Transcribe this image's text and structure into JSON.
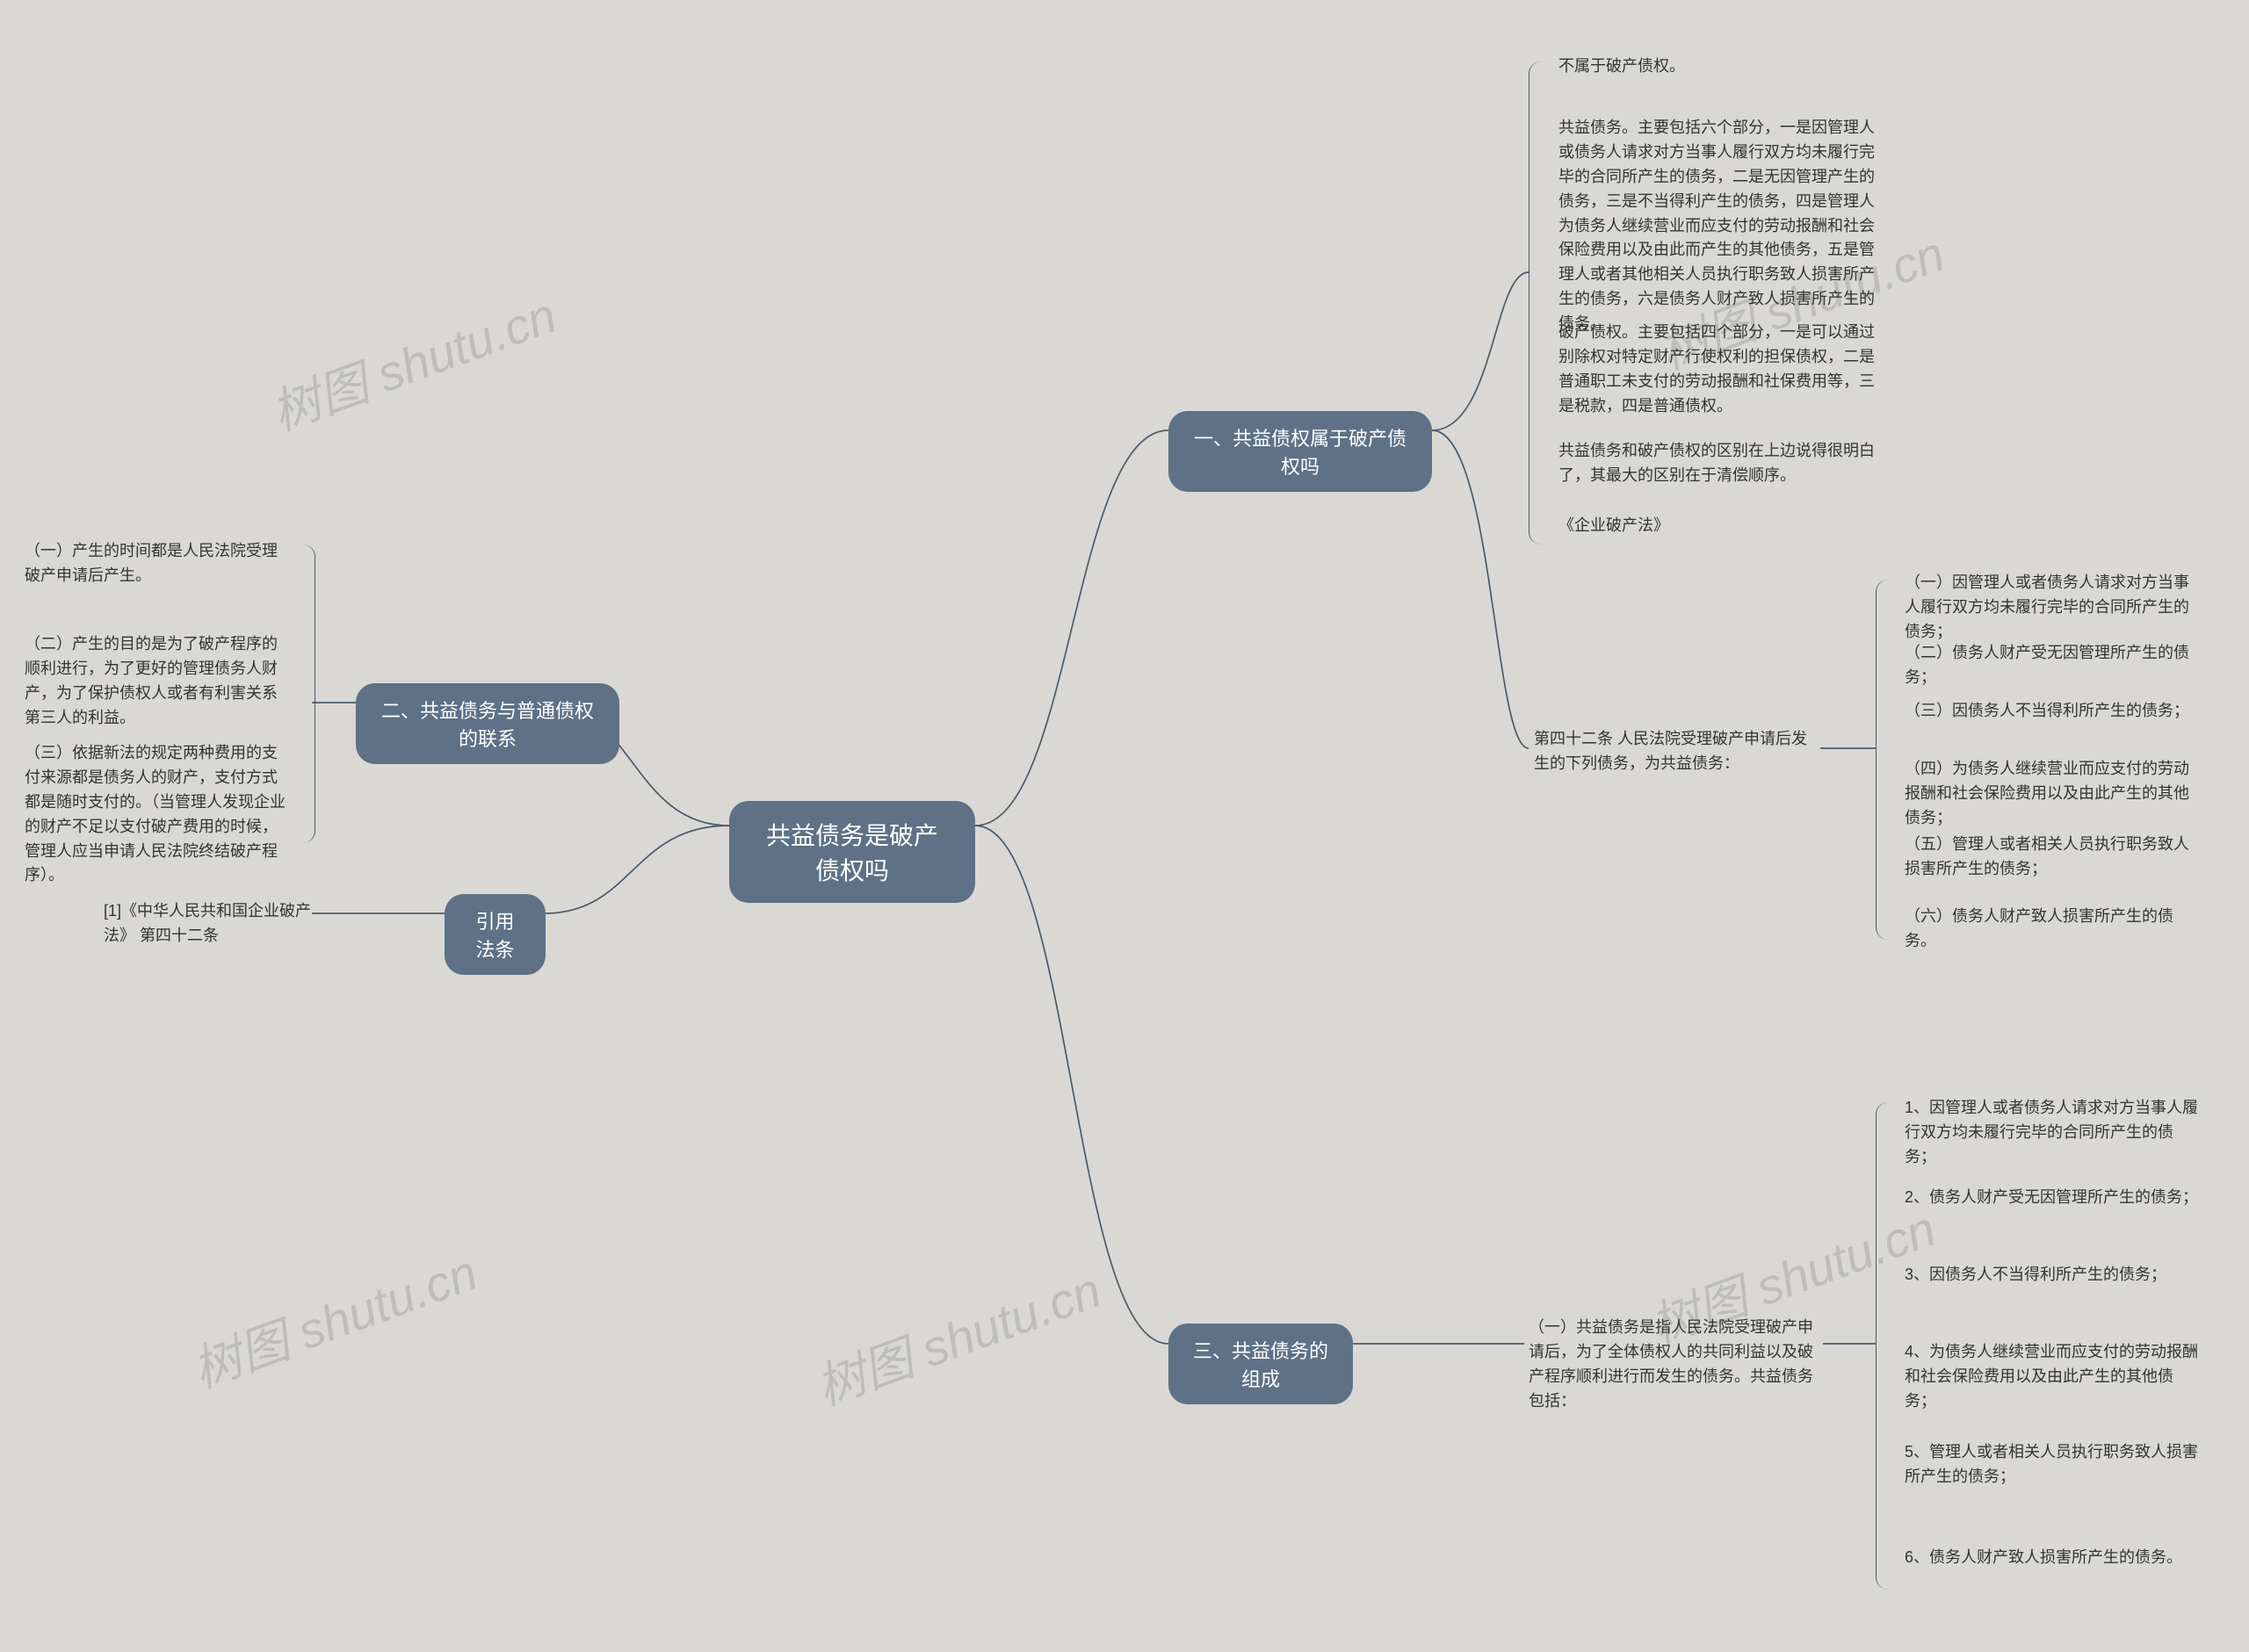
{
  "root": "共益债务是破产债权吗",
  "watermark": "树图 shutu.cn",
  "right": {
    "n1": {
      "label": "一、共益债权属于破产债权吗",
      "leaves": [
        "不属于破产债权。",
        "共益债务。主要包括六个部分，一是因管理人或债务人请求对方当事人履行双方均未履行完毕的合同所产生的债务，二是无因管理产生的债务，三是不当得利产生的债务，四是管理人为债务人继续营业而应支付的劳动报酬和社会保险费用以及由此而产生的其他债务，五是管理人或者其他相关人员执行职务致人损害所产生的债务，六是债务人财产致人损害所产生的债务。",
        "破产债权。主要包括四个部分，一是可以通过别除权对特定财产行使权利的担保债权，二是普通职工未支付的劳动报酬和社保费用等，三是税款，四是普通债权。",
        "共益债务和破产债权的区别在上边说得很明白了，其最大的区别在于清偿顺序。",
        "《企业破产法》"
      ],
      "sub": {
        "label": "第四十二条 人民法院受理破产申请后发生的下列债务，为共益债务：",
        "leaves": [
          "（一）因管理人或者债务人请求对方当事人履行双方均未履行完毕的合同所产生的债务；",
          "（二）债务人财产受无因管理所产生的债务；",
          "（三）因债务人不当得利所产生的债务；",
          "（四）为债务人继续营业而应支付的劳动报酬和社会保险费用以及由此产生的其他债务；",
          "（五）管理人或者相关人员执行职务致人损害所产生的债务；",
          "（六）债务人财产致人损害所产生的债务。"
        ]
      }
    },
    "n3": {
      "label": "三、共益债务的组成",
      "sub": {
        "label": "（一）共益债务是指人民法院受理破产申请后，为了全体债权人的共同利益以及破产程序顺利进行而发生的债务。共益债务包括：",
        "leaves": [
          "1、因管理人或者债务人请求对方当事人履行双方均未履行完毕的合同所产生的债务；",
          "2、债务人财产受无因管理所产生的债务；",
          "3、因债务人不当得利所产生的债务；",
          "4、为债务人继续营业而应支付的劳动报酬和社会保险费用以及由此产生的其他债务；",
          "5、管理人或者相关人员执行职务致人损害所产生的债务；",
          "6、债务人财产致人损害所产生的债务。"
        ]
      }
    }
  },
  "left": {
    "n2": {
      "label": "二、共益债务与普通债权的联系",
      "leaves": [
        "（一）产生的时间都是人民法院受理破产申请后产生。",
        "（二）产生的目的是为了破产程序的顺利进行，为了更好的管理债务人财产，为了保护债权人或者有利害关系第三人的利益。",
        "（三）依据新法的规定两种费用的支付来源都是债务人的财产，支付方式都是随时支付的。（当管理人发现企业的财产不足以支付破产费用的时候，管理人应当申请人民法院终结破产程序）。"
      ]
    },
    "n4": {
      "label": "引用法条",
      "leaves": [
        "[1]《中华人民共和国企业破产法》 第四十二条"
      ]
    }
  }
}
